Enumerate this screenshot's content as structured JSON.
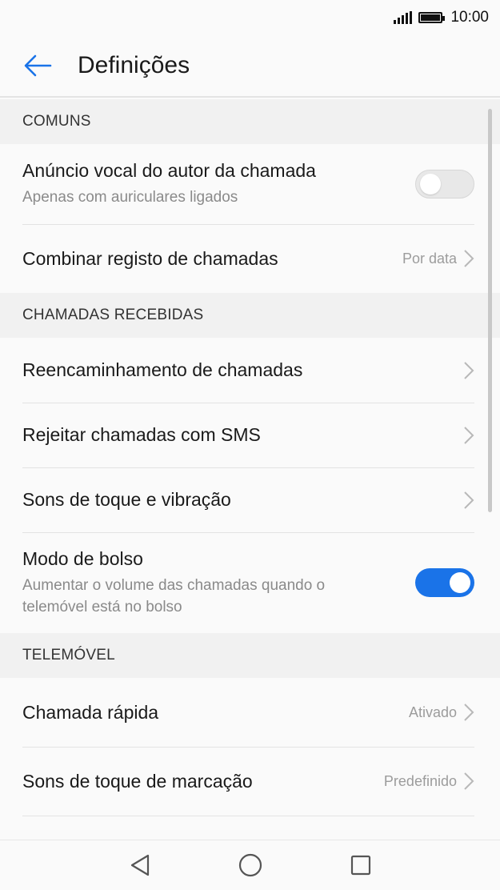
{
  "status_bar": {
    "time": "10:00",
    "signal_icon": "signal-icon",
    "battery_icon": "battery-icon"
  },
  "app_bar": {
    "title": "Definições",
    "back_icon": "arrow-left-icon"
  },
  "sections": {
    "comuns": {
      "header": "COMUNS",
      "anuncio_vocal": {
        "label": "Anúncio vocal do autor da chamada",
        "subtitle": "Apenas com auriculares ligados",
        "toggle": "off"
      },
      "combinar_registo": {
        "label": "Combinar registo de chamadas",
        "value": "Por data"
      }
    },
    "chamadas_recebidas": {
      "header": "CHAMADAS RECEBIDAS",
      "reencaminhamento": {
        "label": "Reencaminhamento de chamadas"
      },
      "rejeitar_sms": {
        "label": "Rejeitar chamadas com SMS"
      },
      "sons_toque_vibracao": {
        "label": "Sons de toque e vibração"
      },
      "modo_bolso": {
        "label": "Modo de bolso",
        "subtitle": "Aumentar o volume das chamadas quando o telemóvel está no bolso",
        "toggle": "on"
      }
    },
    "telemovel": {
      "header": "TELEMÓVEL",
      "chamada_rapida": {
        "label": "Chamada rápida",
        "value": "Ativado"
      },
      "sons_marcacao": {
        "label": "Sons de toque de marcação",
        "value": "Predefinido"
      }
    }
  },
  "colors": {
    "accent": "#1a73e8",
    "toggle_off": "#e8e8e8",
    "section_bg": "#f1f1f1"
  },
  "nav_bar": {
    "back_icon": "triangle-back-icon",
    "home_icon": "circle-home-icon",
    "recents_icon": "square-recents-icon"
  }
}
